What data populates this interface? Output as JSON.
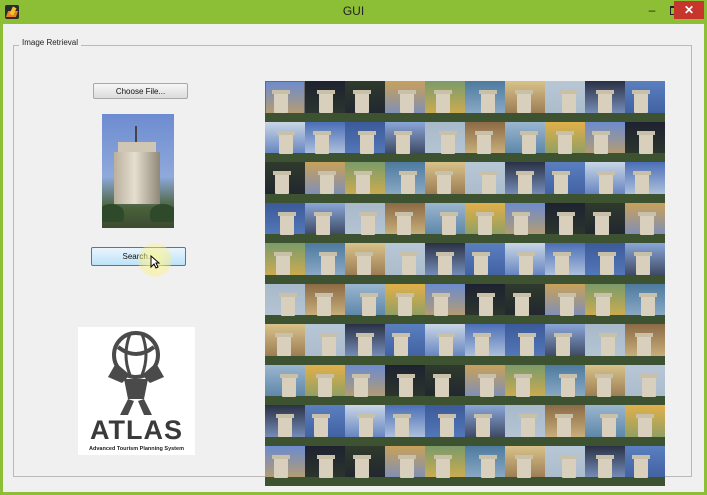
{
  "window": {
    "title": "GUI",
    "minimize": "–",
    "close": "✕",
    "icon": "matlab-icon"
  },
  "panel": {
    "title": "Image Retrieval"
  },
  "buttons": {
    "choose_file": "Choose File...",
    "search": "Search..."
  },
  "logo": {
    "name": "ATLAS",
    "tagline": "Advanced Tourism Planning System"
  },
  "results": {
    "count": 100,
    "palette": [
      "#6c8bcf",
      "#8aa6d8",
      "#2a3145",
      "#c8a15a",
      "#9bb6cf",
      "#4b6fb6",
      "#d9c28a",
      "#1e2230",
      "#a8b9c9",
      "#5a7fbf",
      "#7b9b6a",
      "#e1b04a",
      "#3c5a9a",
      "#b7c7d6",
      "#2f3a2c",
      "#8b6a45",
      "#c9d6e6",
      "#4d7a9e"
    ]
  }
}
